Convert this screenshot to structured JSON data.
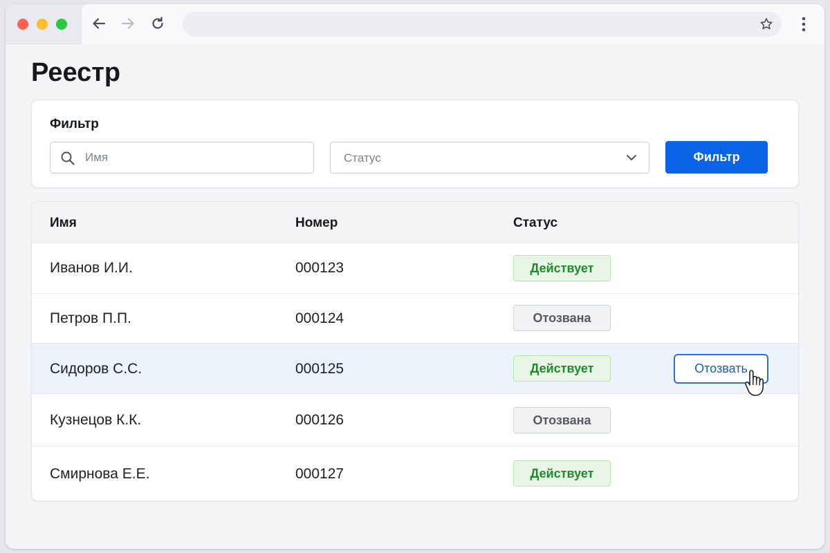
{
  "browser": {
    "address_value": "",
    "colors": {
      "close": "#fe5f57",
      "minimize": "#febc2e",
      "maximize": "#28c840"
    }
  },
  "page": {
    "title": "Реестр"
  },
  "filter": {
    "heading": "Фильтр",
    "name_placeholder": "Имя",
    "status_value": "Статус",
    "button_label": "Фильтр",
    "button_color": "#0b63e5"
  },
  "table": {
    "headers": {
      "name": "Имя",
      "number": "Номер",
      "status": "Статус"
    },
    "rows": [
      {
        "name": "Иванов И.И.",
        "number": "000123",
        "status": "Действует"
      },
      {
        "name": "Петров П.П.",
        "number": "000124",
        "status": "Отозвана"
      },
      {
        "name": "Сидоров С.С.",
        "number": "000125",
        "status": "Действует",
        "action": "Отозвать"
      },
      {
        "name": "Кузнецов К.К.",
        "number": "000126",
        "status": "Отозвана"
      },
      {
        "name": "Смирнова Е.Е.",
        "number": "000127",
        "status": "Действует"
      }
    ],
    "status_colors": {
      "active": "#1f8a2e",
      "revoked": "#555a62"
    },
    "hover_row_color": "#edf3fc"
  }
}
